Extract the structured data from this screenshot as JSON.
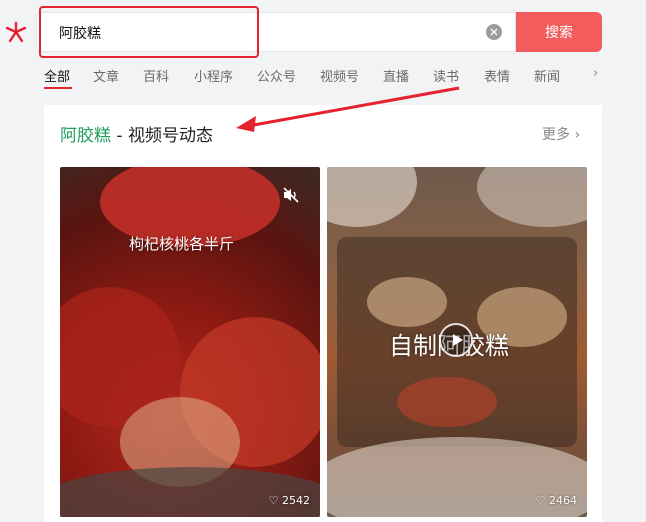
{
  "search": {
    "query": "阿胶糕",
    "button_label": "搜索"
  },
  "tabs": [
    {
      "label": "全部",
      "active": true
    },
    {
      "label": "文章"
    },
    {
      "label": "百科"
    },
    {
      "label": "小程序"
    },
    {
      "label": "公众号"
    },
    {
      "label": "视频号"
    },
    {
      "label": "直播"
    },
    {
      "label": "读书"
    },
    {
      "label": "表情"
    },
    {
      "label": "新闻"
    }
  ],
  "tabs_more_glyph": "›",
  "section": {
    "keyword": "阿胶糕",
    "title_suffix": " - 视频号动态",
    "more_label": "更多 ›"
  },
  "videos": [
    {
      "caption": "枸杞核桃各半斤",
      "likes": "♡ 2542",
      "muted": true
    },
    {
      "caption": "自制阿胶糕",
      "likes": "♡ 2464",
      "has_play_button": true
    }
  ],
  "colors": {
    "accent_red": "#f25c5c",
    "highlight_red": "#e5232e",
    "keyword_green": "#1f9f5e"
  },
  "icons": [
    "logo-icon",
    "clear-icon",
    "mute-icon",
    "play-icon",
    "heart-icon",
    "chevron-right-icon"
  ]
}
